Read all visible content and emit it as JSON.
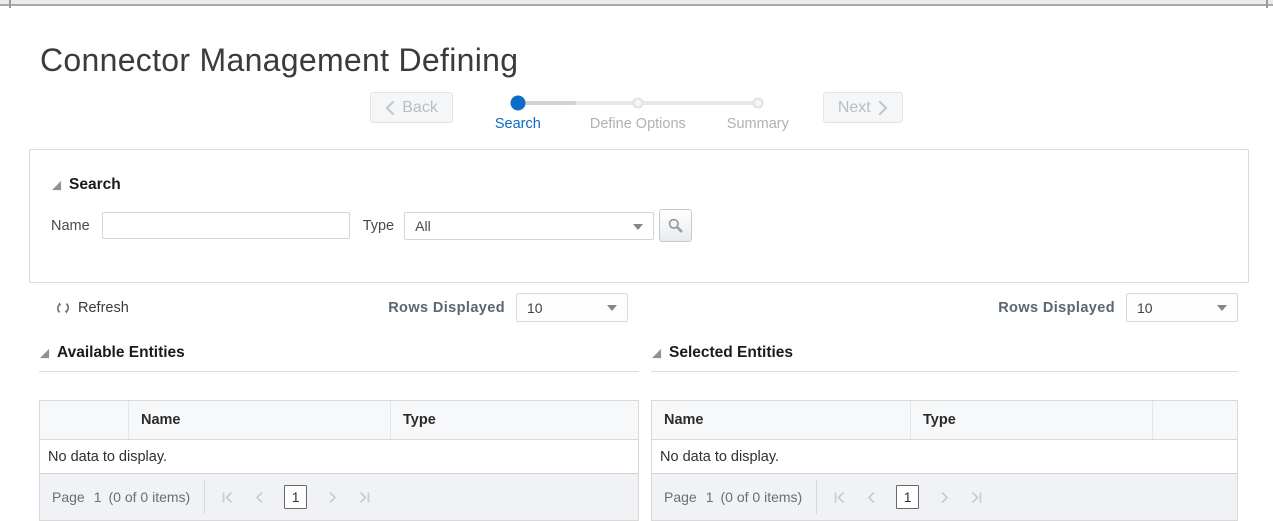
{
  "page": {
    "title": "Connector Management Defining"
  },
  "colors": {
    "accent_blue": "#0d6cc6",
    "disabled_gray": "#b8bec5",
    "footer_bg": "#f0f2f5"
  },
  "icons": {
    "back_chevron": "‹",
    "next_chevron": "›",
    "disclosure_triangle": "◢",
    "refresh": "circular-arrows",
    "search": "magnifier",
    "dropdown_arrow": "▾",
    "page_first": "|‹",
    "page_prev": "‹",
    "page_next": "›",
    "page_last": "›|"
  },
  "wizard": {
    "back_label": "Back",
    "next_label": "Next",
    "steps": [
      {
        "label": "Search",
        "state": "active"
      },
      {
        "label": "Define Options",
        "state": "upcoming"
      },
      {
        "label": "Summary",
        "state": "upcoming"
      }
    ]
  },
  "search_panel": {
    "title": "Search",
    "name_label": "Name",
    "name_value": "",
    "type_label": "Type",
    "type_value": "All"
  },
  "toolbar": {
    "refresh_label": "Refresh",
    "rows_displayed_label": "Rows Displayed",
    "rows_displayed_value": "10"
  },
  "available": {
    "title": "Available Entities",
    "columns": {
      "sel": "",
      "name": "Name",
      "type": "Type"
    },
    "empty_message": "No data to display.",
    "pagination": {
      "page_word": "Page",
      "page_number": "1",
      "items_text": "(0 of 0 items)",
      "current_page": "1"
    }
  },
  "selected": {
    "title": "Selected Entities",
    "columns": {
      "name": "Name",
      "type": "Type",
      "extra": ""
    },
    "empty_message": "No data to display.",
    "pagination": {
      "page_word": "Page",
      "page_number": "1",
      "items_text": "(0 of 0 items)",
      "current_page": "1"
    }
  }
}
